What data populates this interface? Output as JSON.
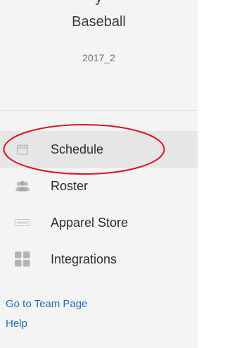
{
  "team": {
    "name_partial": "y",
    "name": "Baseball",
    "season": "2017_2"
  },
  "nav": {
    "items": [
      {
        "label": "Schedule",
        "icon": "calendar-icon",
        "active": true
      },
      {
        "label": "Roster",
        "icon": "people-icon",
        "active": false
      },
      {
        "label": "Apparel Store",
        "icon": "store-icon",
        "active": false
      },
      {
        "label": "Integrations",
        "icon": "grid-icon",
        "active": false
      }
    ]
  },
  "links": {
    "team_page": "Go to Team Page",
    "help": "Help"
  },
  "colors": {
    "sidebar_bg": "#f4f4f4",
    "active_bg": "#e6e6e6",
    "link": "#1e6bb8",
    "annotation": "#e0141b"
  }
}
